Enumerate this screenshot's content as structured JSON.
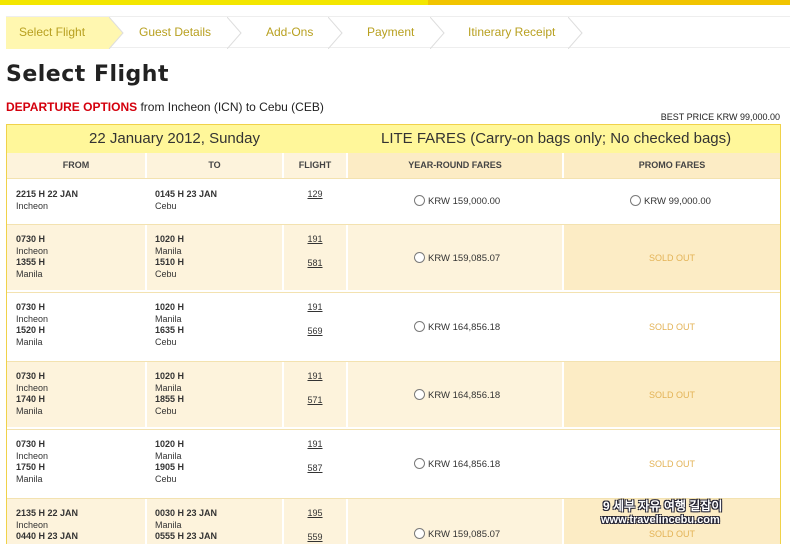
{
  "steps": [
    "Select Flight",
    "Guest Details",
    "Add-Ons",
    "Payment",
    "Itinerary Receipt"
  ],
  "page_title": "Select Flight",
  "departure": {
    "label": "DEPARTURE OPTIONS",
    "text": " from Incheon (ICN) to Cebu (CEB)"
  },
  "best_price": "BEST PRICE KRW  99,000.00",
  "date_header": "22 January 2012, Sunday",
  "fare_header": "LITE FARES (Carry-on bags only; No checked bags)",
  "columns": {
    "from": "FROM",
    "to": "TO",
    "flight": "FLIGHT",
    "year_round": "YEAR-ROUND FARES",
    "promo": "PROMO FARES"
  },
  "rows": [
    {
      "from": [
        {
          "time": "2215 H  22 JAN",
          "city": "Incheon"
        }
      ],
      "to": [
        {
          "time": "0145 H  23 JAN",
          "city": "Cebu"
        }
      ],
      "flights": [
        "129"
      ],
      "year_round": "KRW  159,000.00",
      "promo": "KRW  99,000.00",
      "promo_sold_out": false
    },
    {
      "from": [
        {
          "time": "0730 H",
          "city": "Incheon"
        },
        {
          "time": "1355 H",
          "city": "Manila"
        }
      ],
      "to": [
        {
          "time": "1020 H",
          "city": "Manila"
        },
        {
          "time": "1510 H",
          "city": "Cebu"
        }
      ],
      "flights": [
        "191",
        "581"
      ],
      "year_round": "KRW  159,085.07",
      "promo": "SOLD OUT",
      "promo_sold_out": true
    },
    {
      "from": [
        {
          "time": "0730 H",
          "city": "Incheon"
        },
        {
          "time": "1520 H",
          "city": "Manila"
        }
      ],
      "to": [
        {
          "time": "1020 H",
          "city": "Manila"
        },
        {
          "time": "1635 H",
          "city": "Cebu"
        }
      ],
      "flights": [
        "191",
        "569"
      ],
      "year_round": "KRW  164,856.18",
      "promo": "SOLD OUT",
      "promo_sold_out": true
    },
    {
      "from": [
        {
          "time": "0730 H",
          "city": "Incheon"
        },
        {
          "time": "1740 H",
          "city": "Manila"
        }
      ],
      "to": [
        {
          "time": "1020 H",
          "city": "Manila"
        },
        {
          "time": "1855 H",
          "city": "Cebu"
        }
      ],
      "flights": [
        "191",
        "571"
      ],
      "year_round": "KRW  164,856.18",
      "promo": "SOLD OUT",
      "promo_sold_out": true
    },
    {
      "from": [
        {
          "time": "0730 H",
          "city": "Incheon"
        },
        {
          "time": "1750 H",
          "city": "Manila"
        }
      ],
      "to": [
        {
          "time": "1020 H",
          "city": "Manila"
        },
        {
          "time": "1905 H",
          "city": "Cebu"
        }
      ],
      "flights": [
        "191",
        "587"
      ],
      "year_round": "KRW  164,856.18",
      "promo": "SOLD OUT",
      "promo_sold_out": true
    },
    {
      "from": [
        {
          "time": "2135 H  22 JAN",
          "city": "Incheon"
        },
        {
          "time": "0440 H  23 JAN",
          "city": ""
        }
      ],
      "to": [
        {
          "time": "0030 H  23 JAN",
          "city": "Manila"
        },
        {
          "time": "0555 H  23 JAN",
          "city": ""
        }
      ],
      "flights": [
        "195",
        "559"
      ],
      "year_round": "KRW  159,085.07",
      "promo": "SOLD OUT",
      "promo_sold_out": true
    }
  ],
  "watermark": {
    "line1": "9 세부 자유 여행 길잡이",
    "line2": "www.travelincebu.com"
  },
  "colors": {
    "accent_yellow": "#f3e600",
    "red": "#d4000d",
    "sold_out": "#e3b356"
  }
}
